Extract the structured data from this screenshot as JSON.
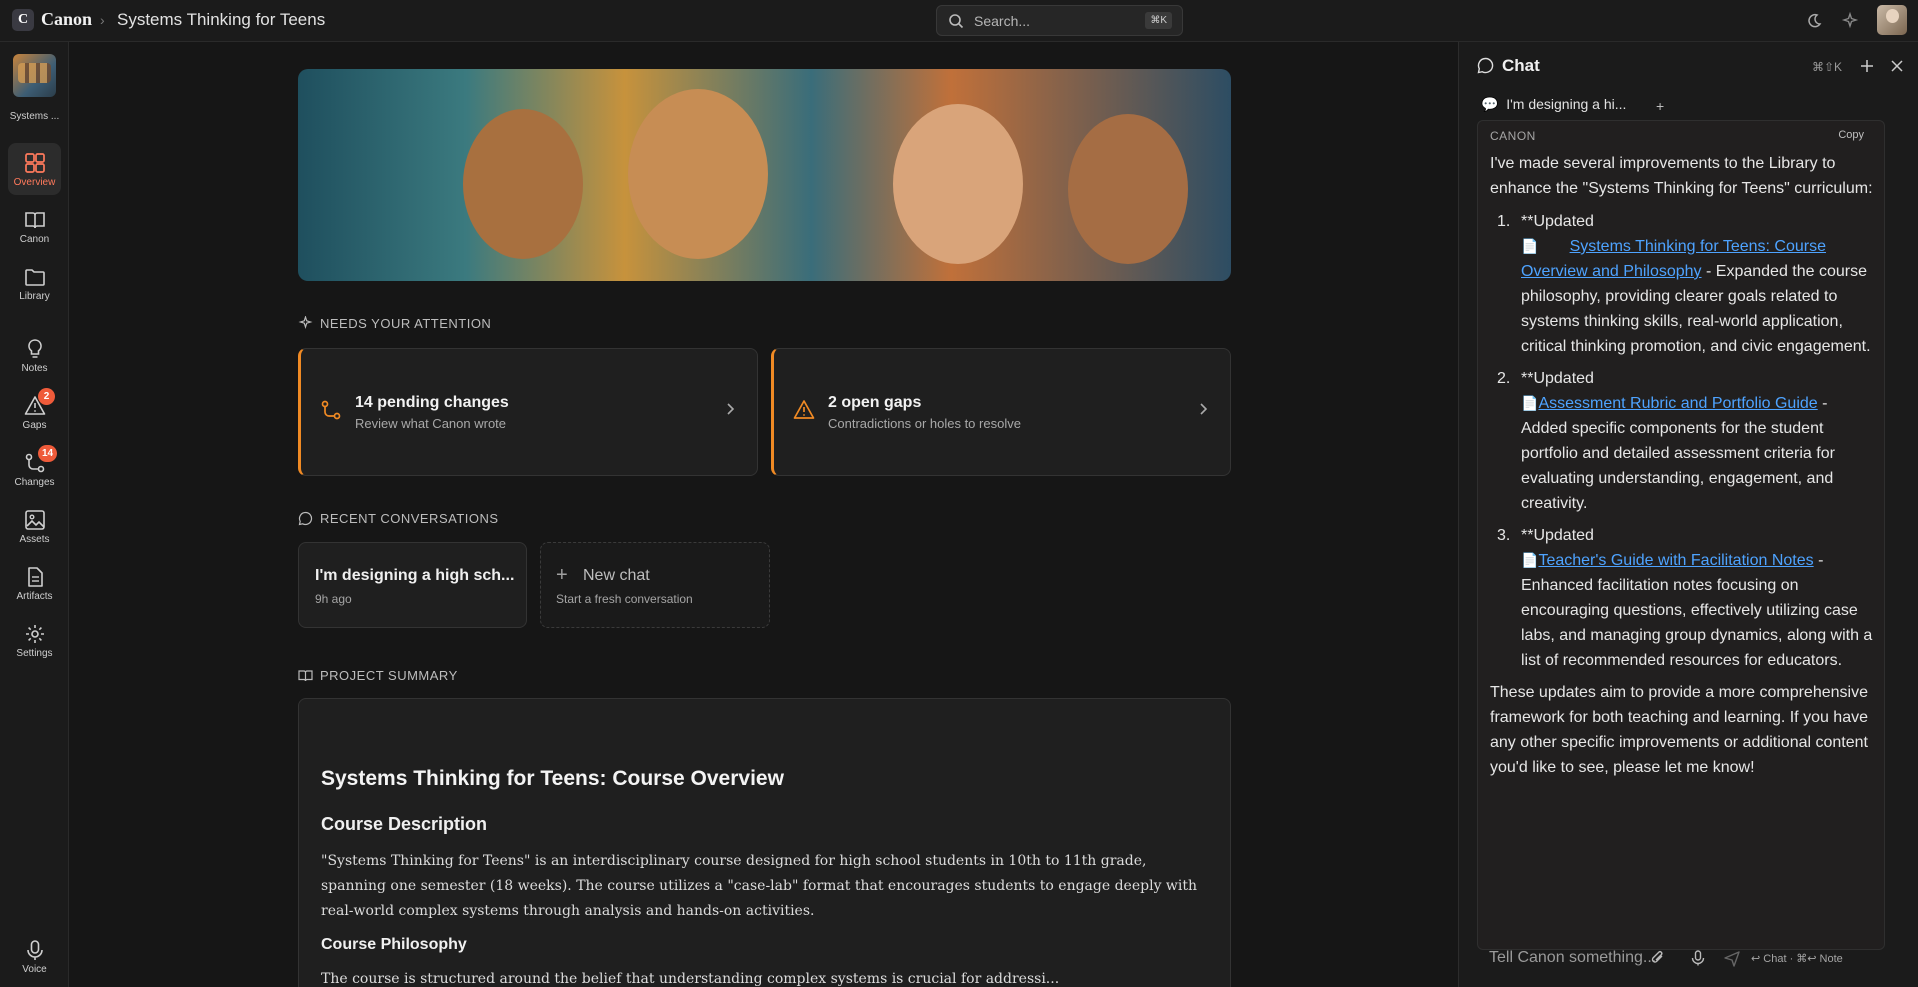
{
  "topbar": {
    "logo_letter": "C",
    "app_name": "Canon",
    "breadcrumb": "Systems Thinking for Teens",
    "search_placeholder": "Search...",
    "search_shortcut": "⌘K"
  },
  "sidebar": {
    "project_label": "Systems ...",
    "items": [
      {
        "label": "Overview",
        "icon": "grid-icon",
        "active": true
      },
      {
        "label": "Canon",
        "icon": "book-icon"
      },
      {
        "label": "Library",
        "icon": "folder-icon"
      },
      {
        "label": "Notes",
        "icon": "lightbulb-icon"
      },
      {
        "label": "Gaps",
        "icon": "warning-icon",
        "badge": "2"
      },
      {
        "label": "Changes",
        "icon": "git-branch-icon",
        "badge": "14"
      },
      {
        "label": "Assets",
        "icon": "image-icon"
      },
      {
        "label": "Artifacts",
        "icon": "document-icon"
      },
      {
        "label": "Settings",
        "icon": "gear-icon"
      },
      {
        "label": "Voice",
        "icon": "microphone-icon"
      }
    ]
  },
  "attention": {
    "heading": "NEEDS YOUR ATTENTION",
    "cards": [
      {
        "title": "14 pending changes",
        "subtitle": "Review what Canon wrote"
      },
      {
        "title": "2 open gaps",
        "subtitle": "Contradictions or holes to resolve"
      }
    ]
  },
  "recent": {
    "heading": "RECENT CONVERSATIONS",
    "conversation_title": "I'm designing a high sch...",
    "conversation_time": "9h ago",
    "new_chat_title": "New chat",
    "new_chat_subtitle": "Start a fresh conversation"
  },
  "summary": {
    "heading": "PROJECT SUMMARY",
    "title": "Systems Thinking for Teens: Course Overview",
    "desc_heading": "Course Description",
    "desc_text": "\"Systems Thinking for Teens\" is an interdisciplinary course designed for high school students in 10th to 11th grade, spanning one semester (18 weeks). The course utilizes a \"case-lab\" format that encourages students to engage deeply with real-world complex systems through analysis and hands-on activities.",
    "philosophy_heading": "Course Philosophy",
    "philosophy_text": "The course is structured around the belief that understanding complex systems is crucial for addressi..."
  },
  "chat": {
    "title": "Chat",
    "shortcut": "⌘⇧K",
    "tab_label": "I'm designing a hi...",
    "tab_add": "+",
    "role": "CANON",
    "copy_label": "Copy",
    "intro": "I've made several improvements to the Library to enhance the \"Systems Thinking for Teens\" curriculum:",
    "items": [
      {
        "num": "1.",
        "prefix": "**Updated",
        "link": "Systems Thinking for Teens: Course Overview and Philosophy",
        "text": "- Expanded the course philosophy, providing clearer goals related to systems thinking skills, real-world application, critical thinking promotion, and civic engagement."
      },
      {
        "num": "2.",
        "prefix": "**Updated",
        "link": "Assessment Rubric and Portfolio Guide",
        "text": "- Added specific components for the student portfolio and detailed assessment criteria for evaluating understanding, engagement, and creativity."
      },
      {
        "num": "3.",
        "prefix": "**Updated",
        "link": "Teacher's Guide with Facilitation Notes",
        "text": "- Enhanced facilitation notes focusing on encouraging questions, effectively utilizing case labs, and managing group dynamics, along with a list of recommended resources for educators."
      }
    ],
    "outro": "These updates aim to provide a more comprehensive framework for both teaching and learning. If you have any other specific improvements or additional content you'd like to see, please let me know!",
    "composer_placeholder": "Tell Canon something...",
    "composer_hint": "↩ Chat · ⌘↩ Note"
  },
  "fab_label": "+"
}
